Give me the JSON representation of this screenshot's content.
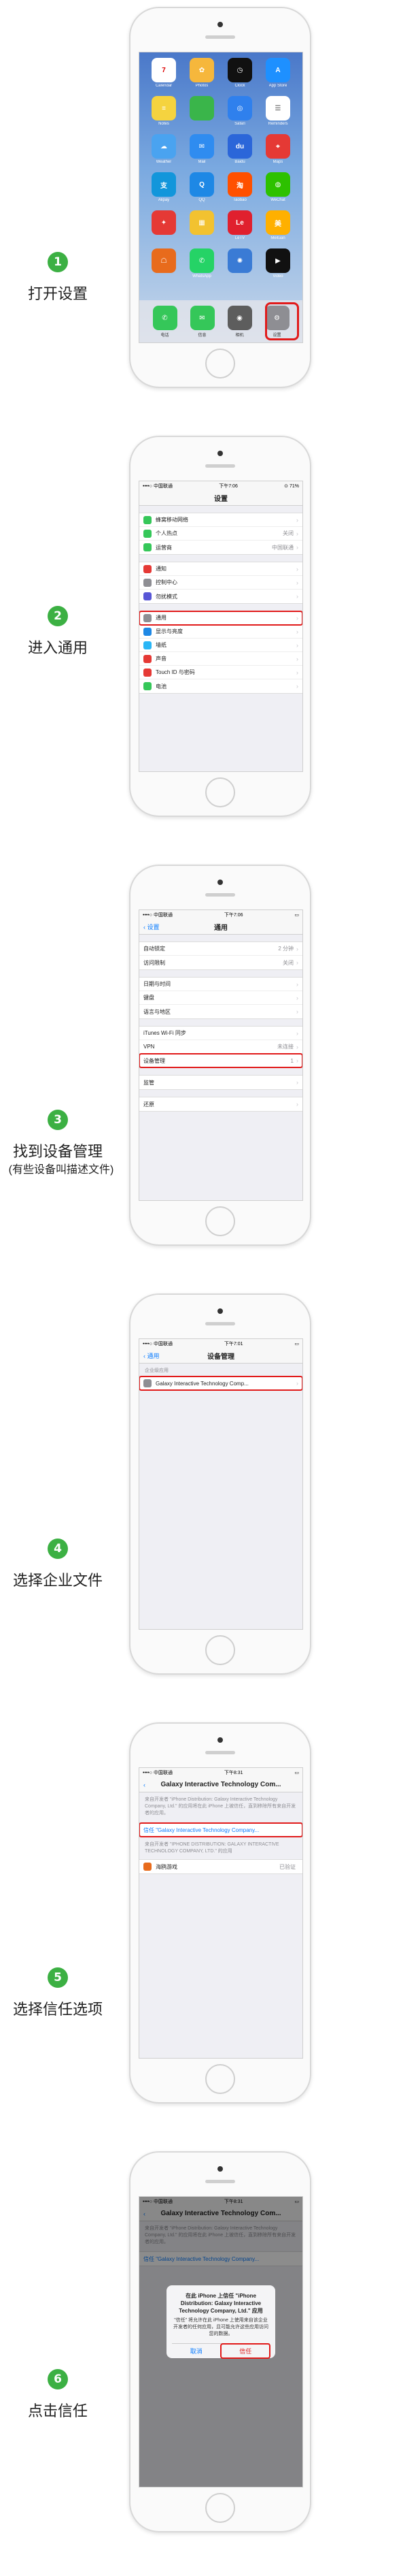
{
  "steps": [
    {
      "number": "1",
      "label": "打开设置"
    },
    {
      "number": "2",
      "label": "进入通用"
    },
    {
      "number": "3",
      "label": "找到设备管理",
      "sublabel": "(有些设备叫描述文件)"
    },
    {
      "number": "4",
      "label": "选择企业文件"
    },
    {
      "number": "5",
      "label": "选择信任选项"
    },
    {
      "number": "6",
      "label": "点击信任"
    }
  ],
  "home": {
    "badge": "2",
    "apps": [
      {
        "name": "Calendar",
        "text": "7",
        "color": "#ffffff",
        "fg": "#d00"
      },
      {
        "name": "Photos",
        "text": "✿",
        "color": "#f6b73c",
        "fg": "#fff"
      },
      {
        "name": "Clock",
        "text": "◷",
        "color": "#111111",
        "fg": "#fff"
      },
      {
        "name": "App Store",
        "text": "A",
        "color": "#1e90ff",
        "fg": "#fff"
      },
      {
        "name": "Notes",
        "text": "≡",
        "color": "#f5d33f",
        "fg": "#fff"
      },
      {
        "name": "",
        "text": "",
        "color": "#3ab54a",
        "fg": "#fff"
      },
      {
        "name": "Safari",
        "text": "◎",
        "color": "#2f80ed",
        "fg": "#fff"
      },
      {
        "name": "Reminders",
        "text": "☰",
        "color": "#ffffff",
        "fg": "#555"
      },
      {
        "name": "Weather",
        "text": "☁",
        "color": "#4aa3f0",
        "fg": "#fff"
      },
      {
        "name": "Mail",
        "text": "✉",
        "color": "#2f8cf0",
        "fg": "#fff"
      },
      {
        "name": "Baidu",
        "text": "du",
        "color": "#2b66d9",
        "fg": "#fff"
      },
      {
        "name": "Maps",
        "text": "⌖",
        "color": "#e53935",
        "fg": "#fff"
      },
      {
        "name": "Alipay",
        "text": "支",
        "color": "#1296db",
        "fg": "#fff"
      },
      {
        "name": "QQ",
        "text": "Q",
        "color": "#1e88e5",
        "fg": "#fff"
      },
      {
        "name": "Taobao",
        "text": "淘",
        "color": "#ff5000",
        "fg": "#fff"
      },
      {
        "name": "WeChat",
        "text": "◍",
        "color": "#2dc100",
        "fg": "#fff"
      },
      {
        "name": "",
        "text": "✦",
        "color": "#e53935",
        "fg": "#fff"
      },
      {
        "name": "",
        "text": "▦",
        "color": "#f2c230",
        "fg": "#fff"
      },
      {
        "name": "LeTV",
        "text": "Le",
        "color": "#e0202e",
        "fg": "#fff"
      },
      {
        "name": "Meituan",
        "text": "美",
        "color": "#ffb000",
        "fg": "#fff"
      },
      {
        "name": "",
        "text": "☖",
        "color": "#e86b1c",
        "fg": "#fff"
      },
      {
        "name": "WhatsApp",
        "text": "✆",
        "color": "#25d366",
        "fg": "#fff"
      },
      {
        "name": "",
        "text": "✺",
        "color": "#3a7bd5",
        "fg": "#fff"
      },
      {
        "name": "Video",
        "text": "▶",
        "color": "#111111",
        "fg": "#fff"
      }
    ],
    "dock": [
      {
        "name": "电话",
        "text": "✆",
        "color": "#35c759"
      },
      {
        "name": "信息",
        "text": "✉",
        "color": "#35c759"
      },
      {
        "name": "相机",
        "text": "◉",
        "color": "#5d5d5d"
      },
      {
        "name": "设置",
        "text": "⚙",
        "color": "#8e8e93"
      }
    ]
  },
  "settings": {
    "status_left": "••••○ 中国联通",
    "status_time": "下午7:06",
    "status_right": "⊙ 71%",
    "title": "设置",
    "group1": [
      {
        "label": "蜂窝移动网络",
        "value": "",
        "color": "#35c759"
      },
      {
        "label": "个人热点",
        "value": "关闭",
        "color": "#35c759"
      },
      {
        "label": "运营商",
        "value": "中国联通",
        "color": "#35c759"
      }
    ],
    "group2": [
      {
        "label": "通知",
        "value": "",
        "color": "#e53935"
      },
      {
        "label": "控制中心",
        "value": "",
        "color": "#8e8e93"
      },
      {
        "label": "勿扰模式",
        "value": "",
        "color": "#5856d6"
      }
    ],
    "group3": [
      {
        "label": "通用",
        "value": "",
        "color": "#8e8e93",
        "hl": true
      },
      {
        "label": "显示与亮度",
        "value": "",
        "color": "#1e88e5"
      },
      {
        "label": "墙纸",
        "value": "",
        "color": "#29b6f6"
      },
      {
        "label": "声音",
        "value": "",
        "color": "#e53935"
      },
      {
        "label": "Touch ID 与密码",
        "value": "",
        "color": "#e53935"
      },
      {
        "label": "电池",
        "value": "",
        "color": "#35c759"
      }
    ]
  },
  "general": {
    "status_left": "••••○ 中国联通",
    "status_time": "下午7:06",
    "back": "设置",
    "title": "通用",
    "rows1": [
      {
        "label": "自动锁定",
        "value": "2 分钟"
      },
      {
        "label": "访问限制",
        "value": "关闭"
      }
    ],
    "rows2": [
      {
        "label": "日期与时间",
        "value": ""
      },
      {
        "label": "键盘",
        "value": ""
      },
      {
        "label": "语言与地区",
        "value": ""
      }
    ],
    "rows3": [
      {
        "label": "iTunes Wi-Fi 同步",
        "value": ""
      },
      {
        "label": "VPN",
        "value": "未连接"
      },
      {
        "label": "设备管理",
        "value": "1",
        "hl": true
      }
    ],
    "rows4": [
      {
        "label": "监管",
        "value": ""
      }
    ],
    "rows5": [
      {
        "label": "还原",
        "value": ""
      }
    ]
  },
  "device_mgmt": {
    "status_left": "••••○ 中国联通",
    "status_time": "下午7:01",
    "back": "通用",
    "title": "设备管理",
    "section": "企业级应用",
    "item": "Galaxy Interactive Technology Comp..."
  },
  "enterprise": {
    "status_left": "••••○ 中国联通",
    "status_time": "下午8:31",
    "title": "Galaxy Interactive Technology Com...",
    "desc": "来自开发者 \"iPhone Distribution: Galaxy Interactive Technology Company, Ltd.\" 的应用将在此 iPhone 上被信任，直到移除所有来自开发者的应用。",
    "trust_link": "信任 \"Galaxy Interactive Technology Company...",
    "note": "来自开发者 \"IPHONE DISTRIBUTION: GALAXY INTERACTIVE TECHNOLOGY COMPANY, LTD.\" 的应用",
    "app_name": "海鸥游戏",
    "app_status": "已验证"
  },
  "trust_alert": {
    "status_left": "••••○ 中国联通",
    "status_time": "下午8:31",
    "title": "在此 iPhone 上信任 \"iPhone Distribution: Galaxy Interactive Technology Company, Ltd.\" 应用",
    "body": "\"信任\" 将允许在此 iPhone 上使用来自该企业开发者的任何应用，且可能允许这些应用访问您的数据。",
    "cancel": "取消",
    "trust": "信任"
  }
}
